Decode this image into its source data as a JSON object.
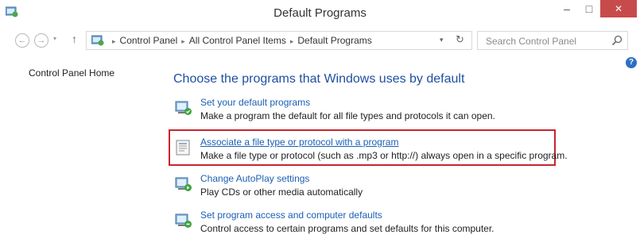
{
  "window": {
    "title": "Default Programs",
    "minimize_glyph": "–",
    "maximize_glyph": "□",
    "close_glyph": "✕"
  },
  "nav": {
    "back_glyph": "←",
    "forward_glyph": "→",
    "recent_glyph": "▾",
    "up_glyph": "↑",
    "breadcrumb": [
      "Control Panel",
      "All Control Panel Items",
      "Default Programs"
    ],
    "breadcrumb_separator": "▸",
    "dropdown_glyph": "▾",
    "refresh_glyph": "↻"
  },
  "search": {
    "placeholder": "Search Control Panel"
  },
  "help_glyph": "?",
  "sidebar": {
    "home_link": "Control Panel Home"
  },
  "main": {
    "heading": "Choose the programs that Windows uses by default",
    "items": [
      {
        "link": "Set your default programs",
        "description": "Make a program the default for all file types and protocols it can open.",
        "icon": "default-programs-icon"
      },
      {
        "link": "Associate a file type or protocol with a program",
        "description": "Make a file type or protocol (such as .mp3 or http://) always open in a specific program.",
        "icon": "file-association-icon"
      },
      {
        "link": "Change AutoPlay settings",
        "description": "Play CDs or other media automatically",
        "icon": "autoplay-icon"
      },
      {
        "link": "Set program access and computer defaults",
        "description": "Control access to certain programs and set defaults for this computer.",
        "icon": "program-access-icon"
      }
    ]
  },
  "colors": {
    "link": "#1c5fb5",
    "heading": "#1f4fa0",
    "highlight_border": "#c8242e",
    "close_button": "#c84b4b"
  }
}
